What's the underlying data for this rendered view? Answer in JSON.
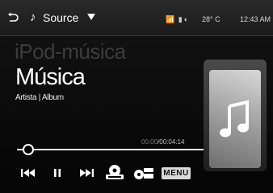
{
  "header": {
    "back_icon": "back-arrow-icon",
    "music_icon": "music-note-icon",
    "note_glyph": "♪",
    "source_label": "Source",
    "status_icons": "📶 ▮◖",
    "temperature": "28° C",
    "time": "12:43 AM"
  },
  "now_playing": {
    "ghost_title": "iPod-música",
    "title": "Música",
    "artist_album": "Artista | Album",
    "elapsed": "00:00",
    "total": "00:04:14",
    "progress": 0.02
  },
  "controls": {
    "menu_label": "MENU",
    "icons": [
      "previous-icon",
      "pause-icon",
      "next-icon",
      "ipod-icon",
      "options-icon"
    ]
  },
  "colors": {
    "background": "#0b0b0b",
    "topbar": "#222222",
    "progress": "#eaeaea"
  }
}
